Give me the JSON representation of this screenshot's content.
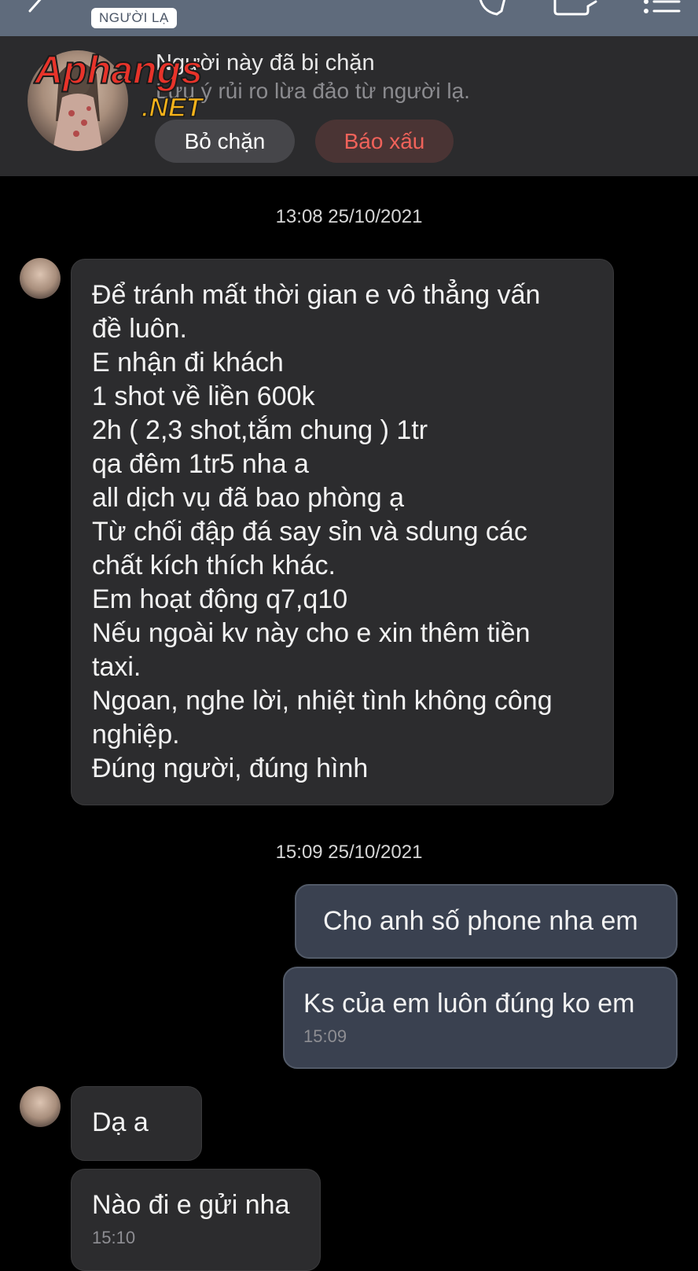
{
  "header": {
    "badge": "NGƯỜI LẠ",
    "icons": [
      "back-arrow-icon",
      "phone-icon",
      "video-icon",
      "menu-icon"
    ]
  },
  "blocked": {
    "title": "Người này đã bị chặn",
    "subtitle": "Lưu ý rủi ro lừa đảo từ người lạ.",
    "unblock_label": "Bỏ chặn",
    "report_label": "Báo xấu"
  },
  "watermark": {
    "line1": "Aphangs",
    "line2": ".NET"
  },
  "conversation": {
    "timestamp1": "13:08 25/10/2021",
    "message1_lines": [
      "Để tránh mất thời gian e vô thẳng vấn",
      "đề luôn.",
      "E nhận đi khách",
      "1 shot về liền 600k",
      "2h ( 2,3 shot,tắm chung ) 1tr",
      "qa đêm 1tr5 nha a",
      "all dịch vụ đã bao phòng ạ",
      "Từ chối đập đá say sỉn và sdung các",
      "chất kích thích khác.",
      "Em hoạt động q7,q10",
      "Nếu ngoài kv này cho e xin thêm tiền",
      "taxi.",
      "Ngoan, nghe lời, nhiệt tình không công",
      "nghiệp.",
      "Đúng người, đúng hình"
    ],
    "timestamp2": "15:09 25/10/2021",
    "out1": "Cho anh số phone nha em",
    "out2": "Ks của em luôn đúng ko em",
    "out2_time": "15:09",
    "in2": "Dạ a",
    "in3": "Nào đi e gửi nha",
    "in3_time": "15:10"
  },
  "colors": {
    "topbar": "#5f6b7c",
    "panel": "#2b2b2d",
    "incoming_bubble": "#2c2c2e",
    "outgoing_bubble": "#3a4150",
    "report_text": "#f0625a"
  }
}
